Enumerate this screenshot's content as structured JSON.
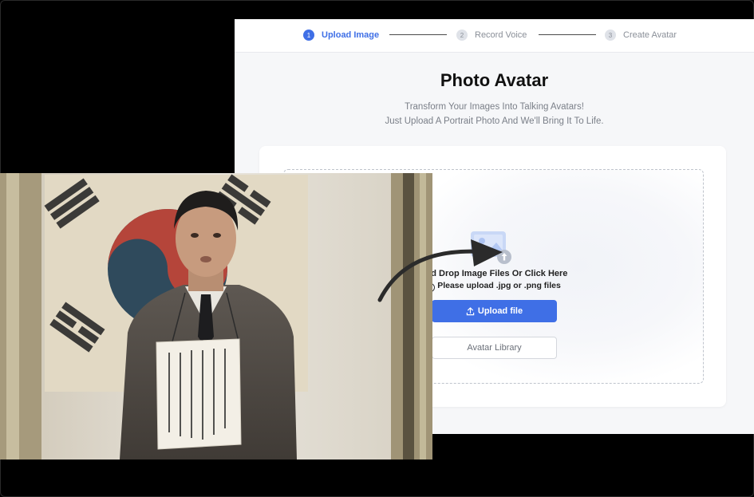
{
  "steps": [
    {
      "num": "1",
      "label": "Upload Image",
      "active": true
    },
    {
      "num": "2",
      "label": "Record Voice",
      "active": false
    },
    {
      "num": "3",
      "label": "Create Avatar",
      "active": false
    }
  ],
  "page": {
    "title": "Photo Avatar",
    "subtitle_line1": "Transform Your Images Into Talking Avatars!",
    "subtitle_line2": "Just Upload A Portrait Photo And We'll Bring It To Life."
  },
  "dropzone": {
    "drop_text": "And Drop Image Files Or Click Here",
    "hint_icon": "i",
    "hint": "Please upload .jpg or .png files",
    "upload_label": "Upload file",
    "library_label": "Avatar Library"
  },
  "overlay_photo": {
    "placard_text": [
      "大",
      "韓",
      "民",
      "國",
      "萬",
      "歲"
    ]
  },
  "icons": {
    "image": "image-upload-icon",
    "upload": "upload-icon",
    "info": "info-icon",
    "arrow": "curved-arrow-icon"
  },
  "colors": {
    "accent": "#3f6fe6",
    "background": "#000000",
    "panel": "#f6f7f9"
  }
}
